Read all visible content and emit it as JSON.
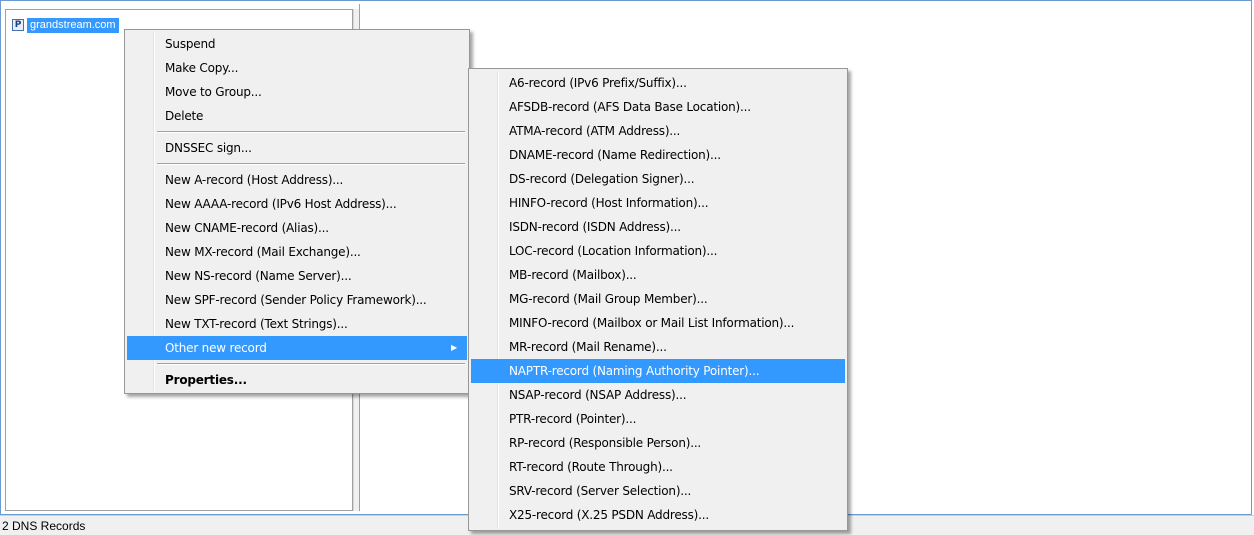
{
  "tree": {
    "zone_label": "grandstream.com",
    "zone_icon_glyph": "P"
  },
  "status": {
    "text": "2 DNS Records"
  },
  "context_menu": {
    "items": [
      "Suspend",
      "Make Copy...",
      "Move to Group...",
      "Delete",
      "DNSSEC sign...",
      "New A-record (Host Address)...",
      "New AAAA-record (IPv6 Host Address)...",
      "New CNAME-record (Alias)...",
      "New MX-record (Mail Exchange)...",
      "New NS-record (Name Server)...",
      "New SPF-record (Sender Policy Framework)...",
      "New TXT-record (Text Strings)...",
      "Other new record",
      "Properties..."
    ],
    "submenu_arrow": "▶"
  },
  "submenu": {
    "items": [
      "A6-record (IPv6 Prefix/Suffix)...",
      "AFSDB-record (AFS Data Base Location)...",
      "ATMA-record (ATM Address)...",
      "DNAME-record (Name Redirection)...",
      "DS-record (Delegation Signer)...",
      "HINFO-record (Host Information)...",
      "ISDN-record (ISDN Address)...",
      "LOC-record (Location Information)...",
      "MB-record (Mailbox)...",
      "MG-record (Mail Group Member)...",
      "MINFO-record (Mailbox or Mail List Information)...",
      "MR-record (Mail Rename)...",
      "NAPTR-record (Naming Authority Pointer)...",
      "NSAP-record (NSAP Address)...",
      "PTR-record (Pointer)...",
      "RP-record (Responsible Person)...",
      "RT-record (Route Through)...",
      "SRV-record (Server Selection)...",
      "X25-record (X.25 PSDN Address)..."
    ]
  },
  "colors": {
    "highlight": "#3399ff",
    "menu_background": "#f0f0f0",
    "frame_border": "#6c9bd2"
  }
}
